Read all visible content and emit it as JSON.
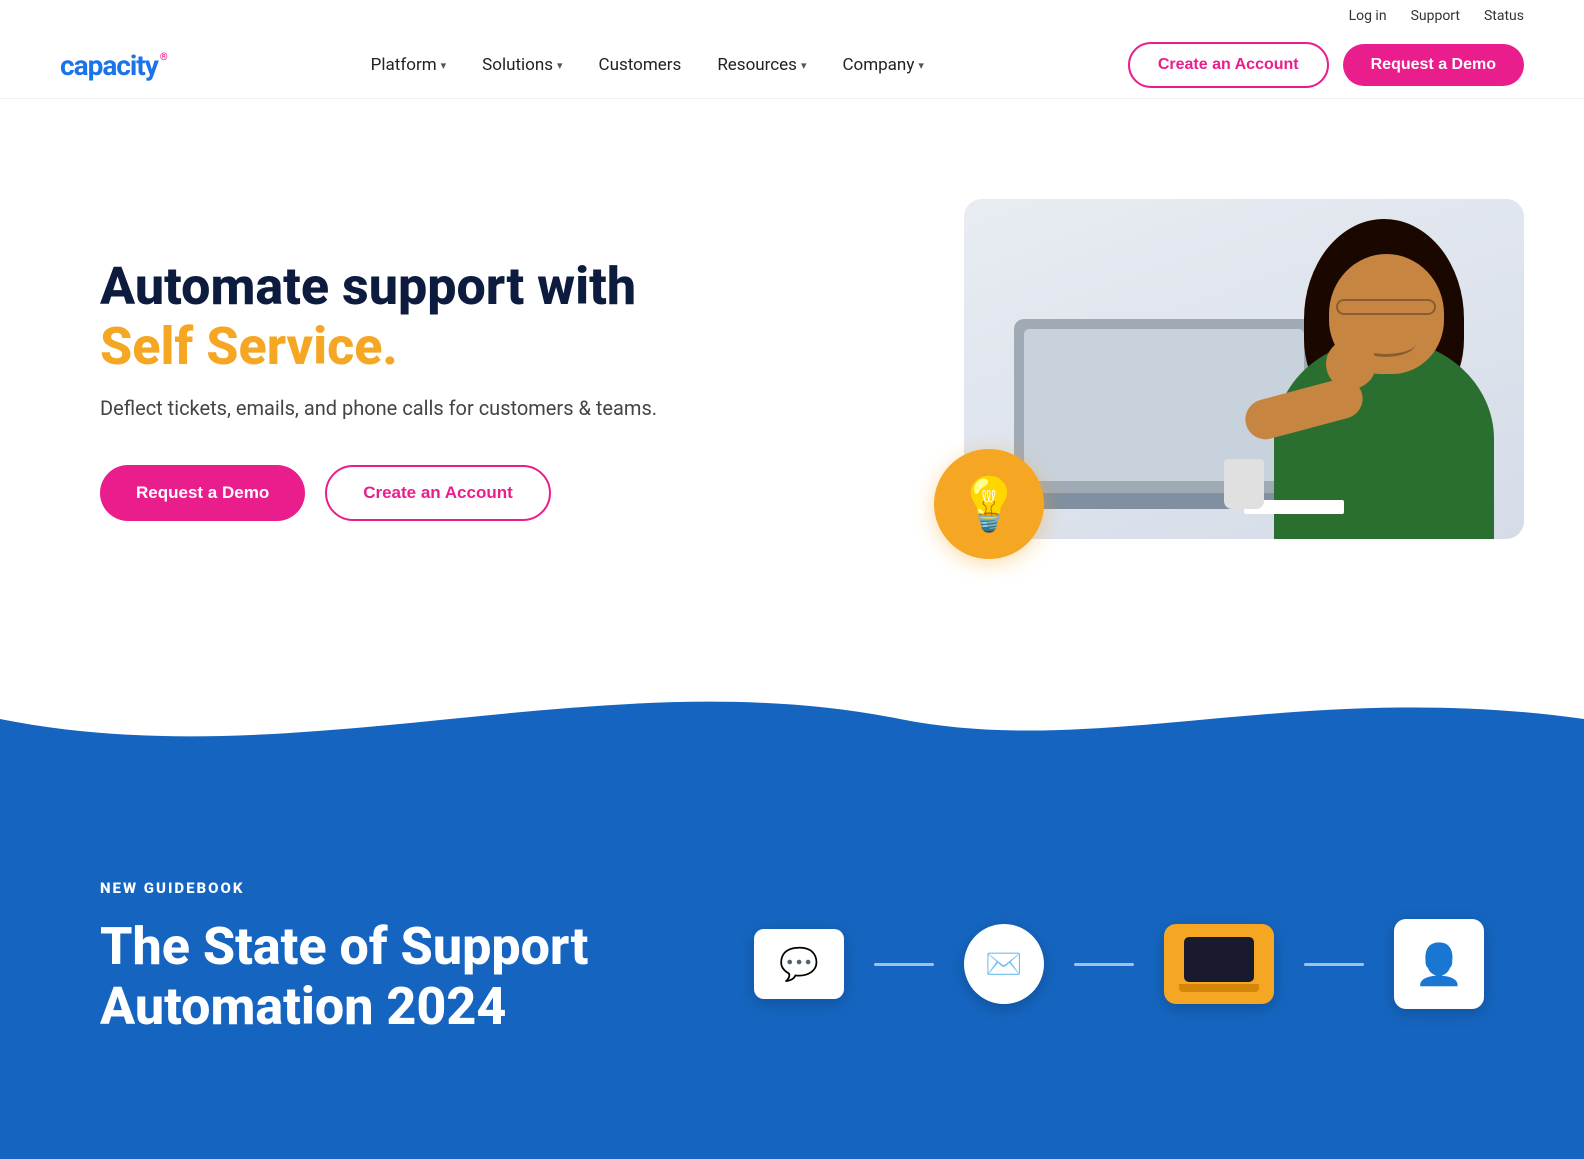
{
  "topbar": {
    "login": "Log in",
    "support": "Support",
    "status": "Status"
  },
  "nav": {
    "logo": "capacity",
    "links": [
      {
        "label": "Platform",
        "hasDropdown": true
      },
      {
        "label": "Solutions",
        "hasDropdown": true
      },
      {
        "label": "Customers",
        "hasDropdown": false
      },
      {
        "label": "Resources",
        "hasDropdown": true
      },
      {
        "label": "Company",
        "hasDropdown": true
      }
    ],
    "cta_outline": "Create an Account",
    "cta_filled": "Request a Demo"
  },
  "hero": {
    "title_line1": "Automate support with",
    "title_highlight": "Self Service.",
    "subtitle": "Deflect tickets, emails, and phone calls for customers & teams.",
    "btn_primary": "Request a Demo",
    "btn_secondary": "Create an Account"
  },
  "blue_section": {
    "eyebrow": "NEW GUIDEBOOK",
    "title_line1": "The State of Support",
    "title_line2": "Automation 2024"
  },
  "icons": {
    "lightbulb": "💡",
    "email": "✉",
    "chat": "💬",
    "person": "👤"
  }
}
